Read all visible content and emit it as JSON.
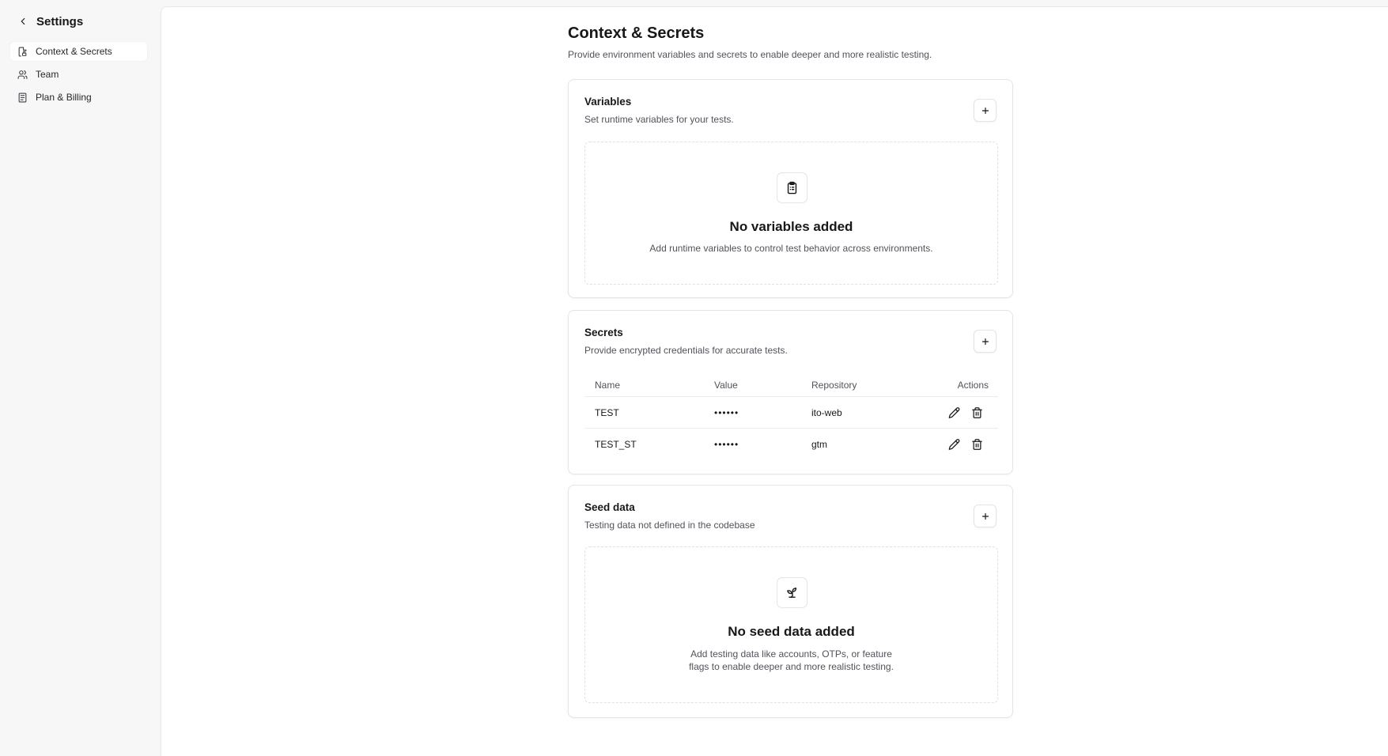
{
  "sidebar": {
    "back_label": "Settings",
    "items": [
      {
        "label": "Context & Secrets",
        "icon": "file-lock-icon",
        "active": true
      },
      {
        "label": "Team",
        "icon": "users-icon",
        "active": false
      },
      {
        "label": "Plan & Billing",
        "icon": "receipt-icon",
        "active": false
      }
    ]
  },
  "page": {
    "title": "Context & Secrets",
    "description": "Provide environment variables and secrets to enable deeper and more realistic testing."
  },
  "variables": {
    "title": "Variables",
    "description": "Set runtime variables for your tests.",
    "add_icon": "plus-icon",
    "empty_icon": "clipboard-list-icon",
    "empty_title": "No variables added",
    "empty_description": "Add runtime variables to control test behavior across environments."
  },
  "secrets": {
    "title": "Secrets",
    "description": "Provide encrypted credentials for accurate tests.",
    "add_icon": "plus-icon",
    "columns": [
      "Name",
      "Value",
      "Repository",
      "Actions"
    ],
    "rows": [
      {
        "name": "TEST",
        "value": "••••••",
        "repository": "ito-web"
      },
      {
        "name": "TEST_ST",
        "value": "••••••",
        "repository": "gtm"
      }
    ],
    "edit_icon": "pencil-icon",
    "delete_icon": "trash-icon"
  },
  "seed_data": {
    "title": "Seed data",
    "description": "Testing data not defined in the codebase",
    "add_icon": "plus-icon",
    "empty_icon": "sprout-icon",
    "empty_title": "No seed data added",
    "empty_description_line1": "Add testing data like accounts, OTPs, or feature",
    "empty_description_line2": "flags to enable deeper and more realistic testing."
  }
}
